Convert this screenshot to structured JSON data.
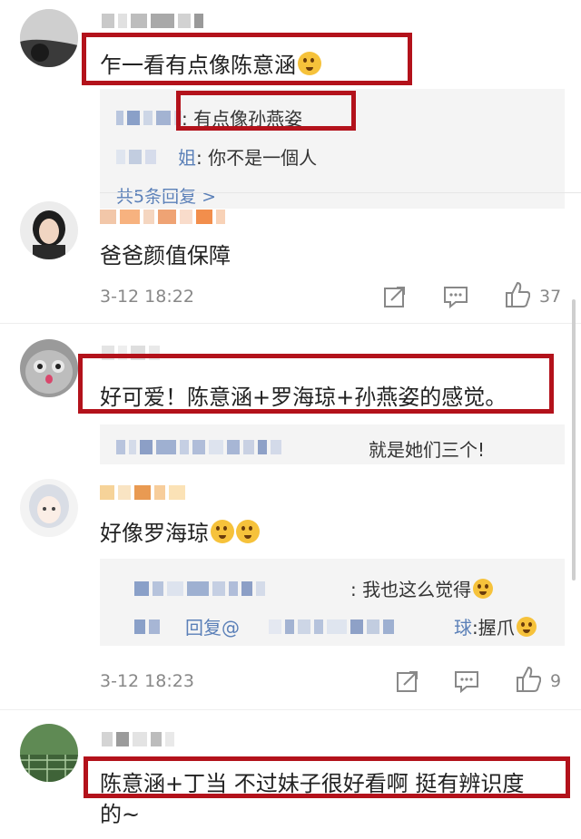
{
  "comments": [
    {
      "text": "乍一看有点像陈意涵",
      "replies": [
        {
          "name": "",
          "text": ": 有点像孙燕姿"
        },
        {
          "name": "姐",
          "text": ": 你不是一個人"
        }
      ],
      "reply_count": "共5条回复 >"
    },
    {
      "text": "爸爸颜值保障",
      "time": "3-12 18:22",
      "likes": "37"
    },
    {
      "text": "好可爱！陈意涵+罗海琼+孙燕姿的感觉。",
      "replies": [
        {
          "text": "就是她们三个!"
        }
      ]
    },
    {
      "text": "好像罗海琼",
      "replies": [
        {
          "text": ": 我也这么觉得"
        },
        {
          "prefix": "回复@",
          "mention_tail": "球",
          "text": ":握爪"
        }
      ],
      "time": "3-12 18:23",
      "likes": "9"
    },
    {
      "text": "陈意涵+丁当 不过妹子很好看啊 挺有辨识度",
      "text_cont": "的~"
    }
  ],
  "colors": {
    "highlight": "#b3121b",
    "link": "#5b80b8",
    "reply_bg": "#f4f4f4"
  },
  "icons": [
    "share-icon",
    "comment-icon",
    "thumbs-up-icon",
    "emoji-icon"
  ]
}
